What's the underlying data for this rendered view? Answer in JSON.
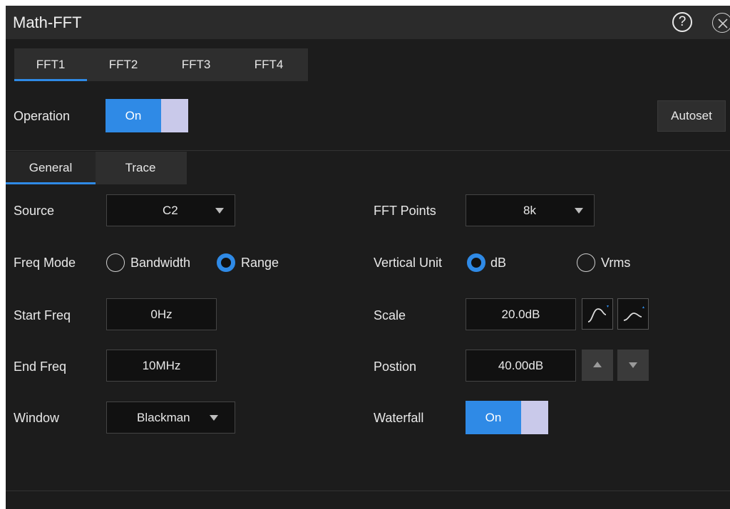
{
  "window": {
    "title": "Math-FFT",
    "help_glyph": "?",
    "icons": [
      "help-icon",
      "close-icon"
    ]
  },
  "fft_tabs": {
    "items": [
      "FFT1",
      "FFT2",
      "FFT3",
      "FFT4"
    ],
    "active": "FFT1"
  },
  "operation": {
    "label": "Operation",
    "toggle_value": "On"
  },
  "autoset_label": "Autoset",
  "sub_tabs": {
    "items": [
      "General",
      "Trace"
    ],
    "active": "General"
  },
  "source": {
    "label": "Source",
    "value": "C2"
  },
  "freq_mode": {
    "label": "Freq Mode",
    "options": [
      "Bandwidth",
      "Range"
    ],
    "selected": "Range"
  },
  "start_freq": {
    "label": "Start Freq",
    "value": "0Hz"
  },
  "end_freq": {
    "label": "End Freq",
    "value": "10MHz"
  },
  "window_fn": {
    "label": "Window",
    "value": "Blackman"
  },
  "fft_points": {
    "label": "FFT Points",
    "value": "8k"
  },
  "vertical_unit": {
    "label": "Vertical Unit",
    "options": [
      "dB",
      "Vrms"
    ],
    "selected": "dB"
  },
  "scale": {
    "label": "Scale",
    "value": "20.0dB"
  },
  "position": {
    "label": "Postion",
    "value": "40.00dB"
  },
  "waterfall": {
    "label": "Waterfall",
    "toggle_value": "On"
  },
  "colors": {
    "accent": "#2f8ae6",
    "toggle_off_part": "#c9c9ea",
    "panel_bg": "#1c1c1c",
    "title_bg": "#2b2b2b"
  }
}
